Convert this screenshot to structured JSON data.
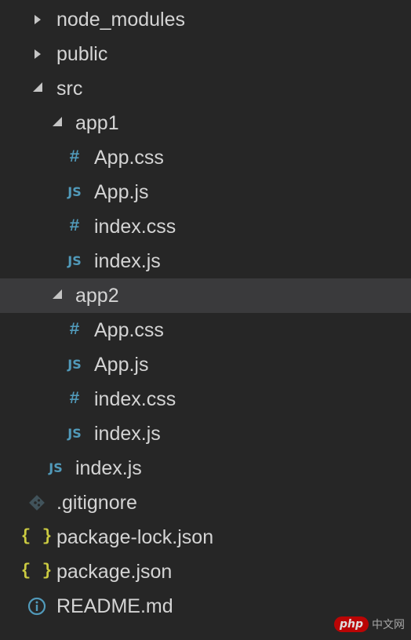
{
  "explorer": {
    "node_modules": "node_modules",
    "public": "public",
    "src": "src",
    "app1": {
      "folder": "app1",
      "app_css": "App.css",
      "app_js": "App.js",
      "index_css": "index.css",
      "index_js": "index.js"
    },
    "app2": {
      "folder": "app2",
      "app_css": "App.css",
      "app_js": "App.js",
      "index_css": "index.css",
      "index_js": "index.js"
    },
    "src_index_js": "index.js",
    "gitignore": ".gitignore",
    "package_lock": "package-lock.json",
    "package_json": "package.json",
    "readme": "README.md"
  },
  "icons": {
    "css_glyph": "#",
    "js_glyph": "JS",
    "json_glyph": "{ }"
  },
  "colors": {
    "background": "#262626",
    "selected_row": "#3a3a3c",
    "text": "#d4d4d4",
    "css_js_icon": "#519aba",
    "json_icon": "#cbcb41"
  },
  "watermark": {
    "badge": "php",
    "text": "中文网"
  }
}
